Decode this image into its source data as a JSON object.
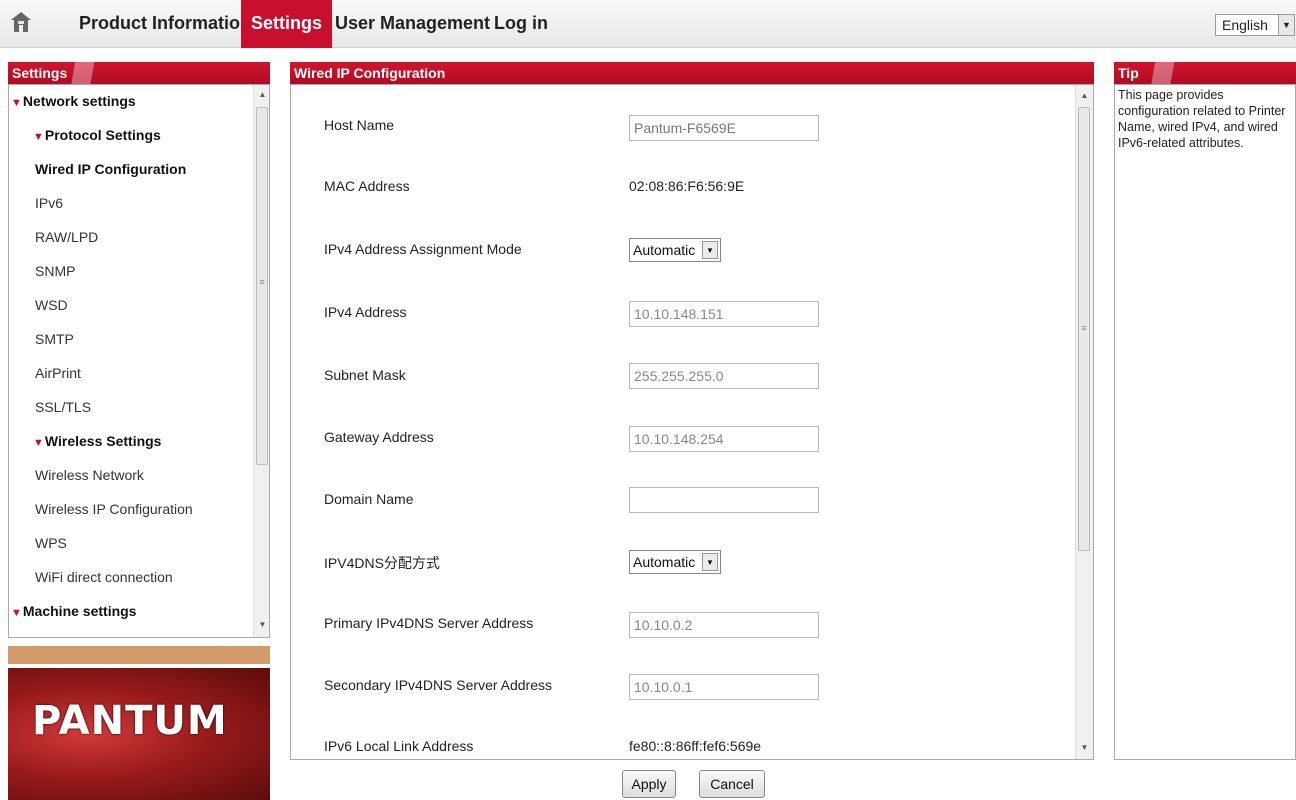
{
  "nav": {
    "items": [
      "Product Information",
      "Settings",
      "User Management",
      "Log in"
    ],
    "active": "Settings",
    "language": "English"
  },
  "left": {
    "header": "Settings",
    "tree": [
      {
        "label": "Network settings",
        "level": 1
      },
      {
        "label": "Protocol Settings",
        "level": 2
      },
      {
        "label": "Wired IP Configuration",
        "level": 3,
        "selected": true
      },
      {
        "label": "IPv6",
        "level": 3
      },
      {
        "label": "RAW/LPD",
        "level": 3
      },
      {
        "label": "SNMP",
        "level": 3
      },
      {
        "label": "WSD",
        "level": 3
      },
      {
        "label": "SMTP",
        "level": 3
      },
      {
        "label": "AirPrint",
        "level": 3
      },
      {
        "label": "SSL/TLS",
        "level": 3
      },
      {
        "label": "Wireless Settings",
        "level": 2
      },
      {
        "label": "Wireless Network",
        "level": 3
      },
      {
        "label": "Wireless IP Configuration",
        "level": 3
      },
      {
        "label": "WPS",
        "level": 3
      },
      {
        "label": "WiFi direct connection",
        "level": 3
      },
      {
        "label": "Machine settings",
        "level": 1
      }
    ],
    "logo": "PANTUM"
  },
  "main": {
    "header": "Wired IP Configuration",
    "fields": {
      "host_name": {
        "label": "Host Name",
        "value": "Pantum-F6569E"
      },
      "mac": {
        "label": "MAC Address",
        "value": "02:08:86:F6:56:9E"
      },
      "ipv4_mode": {
        "label": "IPv4 Address Assignment Mode",
        "value": "Automatic"
      },
      "ipv4_address": {
        "label": "IPv4 Address",
        "value": "10.10.148.151"
      },
      "subnet": {
        "label": "Subnet Mask",
        "value": "255.255.255.0"
      },
      "gateway": {
        "label": "Gateway Address",
        "value": "10.10.148.254"
      },
      "domain": {
        "label": "Domain Name",
        "value": ""
      },
      "dns_mode": {
        "label": "IPV4DNS分配方式",
        "value": "Automatic"
      },
      "dns_primary": {
        "label": "Primary IPv4DNS Server Address",
        "value": "10.10.0.2"
      },
      "dns_secondary": {
        "label": "Secondary IPv4DNS Server Address",
        "value": "10.10.0.1"
      },
      "ipv6_link": {
        "label": "IPv6 Local Link Address",
        "value": "fe80::8:86ff:fef6:569e"
      }
    },
    "apply_label": "Apply",
    "cancel_label": "Cancel"
  },
  "tip": {
    "header": "Tip",
    "text": "This page provides configuration related to Printer Name, wired IPv4, and wired IPv6-related attributes."
  },
  "colors": {
    "accent": "#c8102e",
    "logo_stripe": "#d49b6b"
  }
}
